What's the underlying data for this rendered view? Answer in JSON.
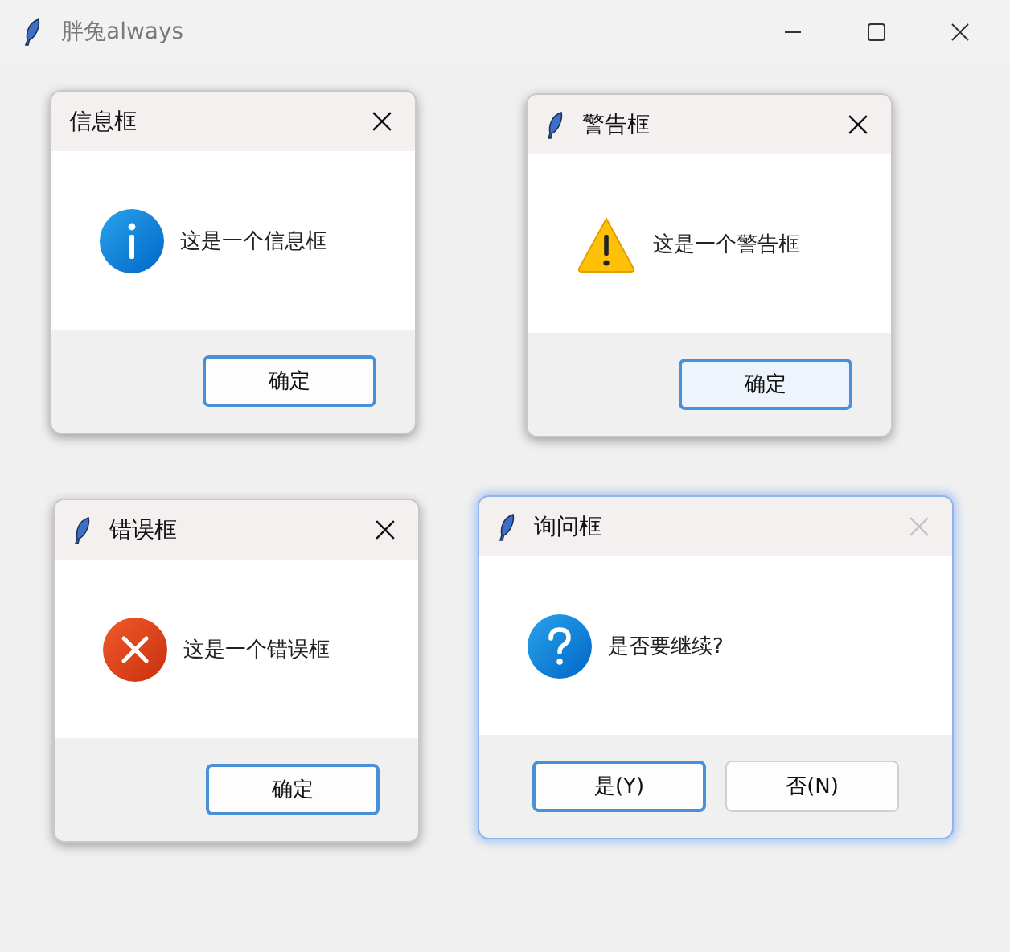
{
  "window": {
    "title": "胖兔always"
  },
  "dialogs": [
    {
      "kind": "info",
      "title": "信息框",
      "app_icon": false,
      "focused": false,
      "close_disabled": false,
      "message": "这是一个信息框",
      "buttons": [
        {
          "label": "确定",
          "default": true,
          "hovered": false
        }
      ]
    },
    {
      "kind": "warning",
      "title": "警告框",
      "app_icon": true,
      "focused": false,
      "close_disabled": false,
      "message": "这是一个警告框",
      "buttons": [
        {
          "label": "确定",
          "default": true,
          "hovered": true
        }
      ]
    },
    {
      "kind": "error",
      "title": "错误框",
      "app_icon": true,
      "focused": false,
      "close_disabled": false,
      "message": "这是一个错误框",
      "buttons": [
        {
          "label": "确定",
          "default": true,
          "hovered": false
        }
      ]
    },
    {
      "kind": "question",
      "title": "询问框",
      "app_icon": true,
      "focused": true,
      "close_disabled": true,
      "message": "是否要继续?",
      "buttons": [
        {
          "label": "是(Y)",
          "default": true,
          "hovered": false
        },
        {
          "label": "否(N)",
          "default": false,
          "hovered": false
        }
      ]
    }
  ]
}
